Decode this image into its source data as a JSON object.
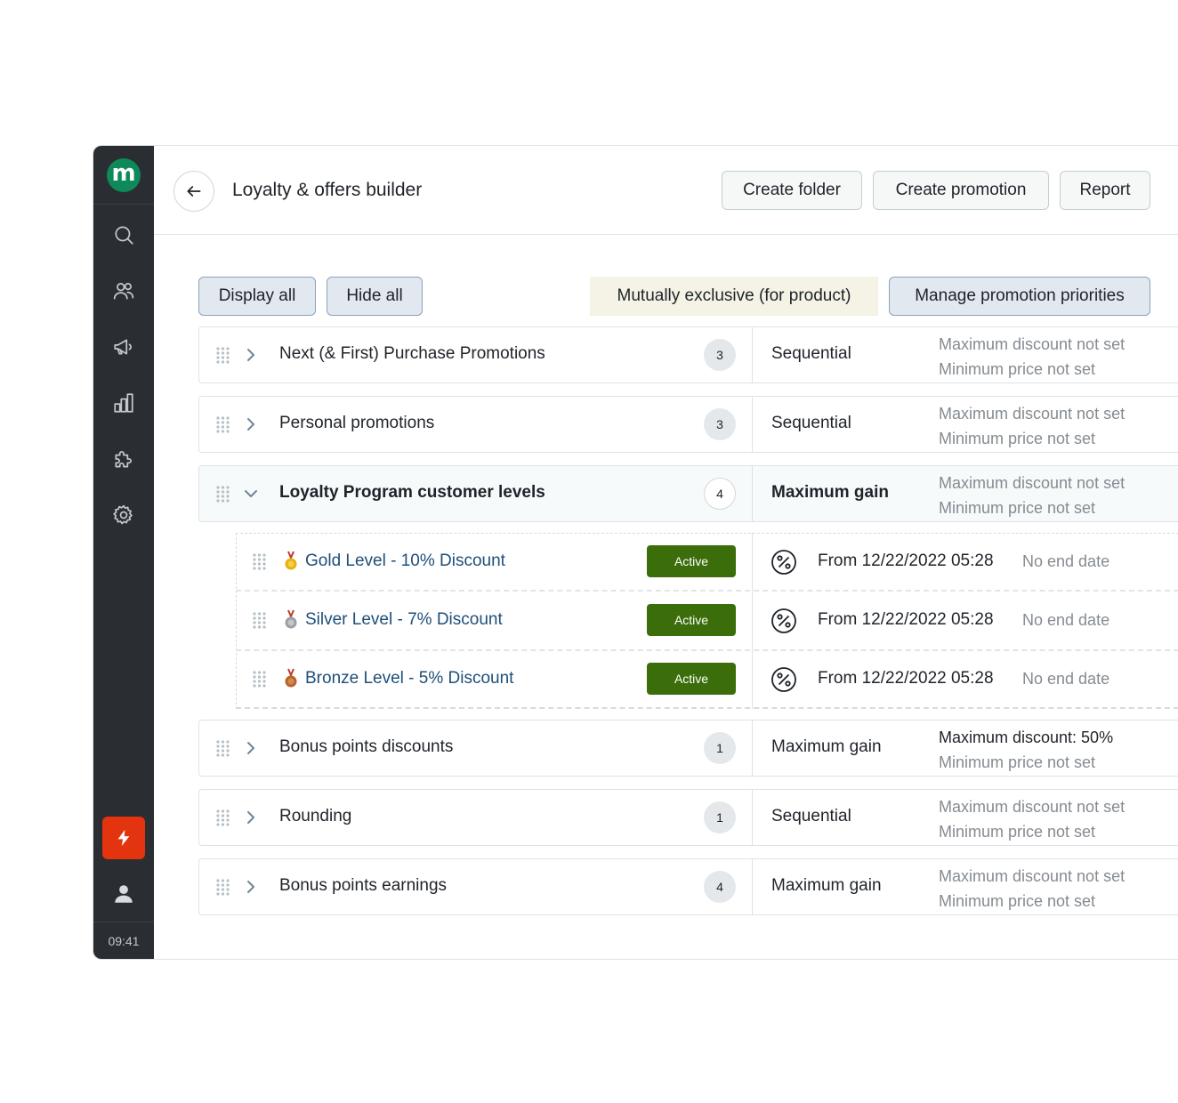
{
  "sidebar": {
    "logo_letter": "m",
    "nav_icons": [
      "search-icon",
      "users-icon",
      "megaphone-icon",
      "chart-icon",
      "puzzle-icon",
      "gear-icon"
    ],
    "clock": "09:41"
  },
  "header": {
    "title": "Loyalty & offers builder",
    "buttons": {
      "create_folder": "Create folder",
      "create_promotion": "Create promotion",
      "report": "Report"
    }
  },
  "toolbar": {
    "display_all": "Display all",
    "hide_all": "Hide all",
    "mutually_exclusive": "Mutually exclusive (for product)",
    "manage_priorities": "Manage promotion priorities"
  },
  "groups": [
    {
      "title": "Next (& First) Purchase Promotions",
      "count": "3",
      "mode": "Sequential",
      "max_discount": "Maximum discount not set",
      "min_price": "Minimum price not set",
      "expanded": false
    },
    {
      "title": "Personal promotions",
      "count": "3",
      "mode": "Sequential",
      "max_discount": "Maximum discount not set",
      "min_price": "Minimum price not set",
      "expanded": false
    },
    {
      "title": "Loyalty Program customer levels",
      "count": "4",
      "mode": "Maximum gain",
      "max_discount": "Maximum discount not set",
      "min_price": "Minimum price not set",
      "expanded": true
    },
    {
      "title": "Bonus points discounts",
      "count": "1",
      "mode": "Maximum gain",
      "max_discount": "Maximum discount: 50%",
      "min_price": "Minimum price not set",
      "expanded": false
    },
    {
      "title": "Rounding",
      "count": "1",
      "mode": "Sequential",
      "max_discount": "Maximum discount not set",
      "min_price": "Minimum price not set",
      "expanded": false
    },
    {
      "title": "Bonus points earnings",
      "count": "4",
      "mode": "Maximum gain",
      "max_discount": "Maximum discount not set",
      "min_price": "Minimum price not set",
      "expanded": false
    }
  ],
  "promotions": [
    {
      "title": "Gold Level - 10% Discount",
      "medal": "gold-medal-icon",
      "status": "Active",
      "from": "From 12/22/2022 05:28",
      "end": "No end date"
    },
    {
      "title": "Silver Level - 7% Discount",
      "medal": "silver-medal-icon",
      "status": "Active",
      "from": "From 12/22/2022 05:28",
      "end": "No end date"
    },
    {
      "title": "Bronze Level - 5% Discount",
      "medal": "bronze-medal-icon",
      "status": "Active",
      "from": "From 12/22/2022 05:28",
      "end": "No end date"
    }
  ],
  "colors": {
    "sidebar_bg": "#2a2d31",
    "logo_green": "#0e8a5a",
    "flash_red": "#e3330f",
    "active_badge": "#3b6d0a",
    "promo_link": "#1e4f79",
    "gold": "#e8b20e",
    "silver": "#9aa0a6",
    "bronze": "#b5652c"
  }
}
